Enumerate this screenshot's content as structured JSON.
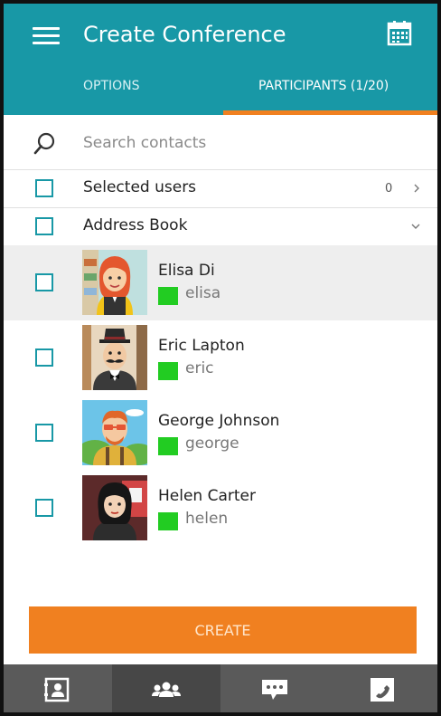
{
  "header": {
    "title": "Create Conference",
    "menu_icon": "hamburger-menu-icon",
    "calendar_icon": "calendar-icon",
    "background_color": "#1898a6",
    "tabs": [
      {
        "label": "OPTIONS",
        "active": false
      },
      {
        "label": "PARTICIPANTS (1/20)",
        "active": true
      }
    ],
    "tab_indicator_color": "#f08020"
  },
  "search": {
    "placeholder": "Search contacts",
    "value": "",
    "icon": "search-icon"
  },
  "selected_users": {
    "label": "Selected users",
    "count": "0",
    "icon": "chevron-right-icon"
  },
  "address_book": {
    "label": "Address Book",
    "icon": "chevron-down-icon"
  },
  "contacts": [
    {
      "name": "Elisa Di",
      "username": "elisa",
      "status_color": "#22cc22",
      "highlighted": true
    },
    {
      "name": "Eric Lapton",
      "username": "eric",
      "status_color": "#22cc22",
      "highlighted": false
    },
    {
      "name": "George Johnson",
      "username": "george",
      "status_color": "#22cc22",
      "highlighted": false
    },
    {
      "name": "Helen Carter",
      "username": "helen",
      "status_color": "#22cc22",
      "highlighted": false
    }
  ],
  "actions": {
    "create_label": "CREATE",
    "create_color": "#f08020"
  },
  "bottom_nav": [
    {
      "icon": "contact-card-icon",
      "active": false
    },
    {
      "icon": "group-icon",
      "active": true
    },
    {
      "icon": "chat-icon",
      "active": false
    },
    {
      "icon": "phone-icon",
      "active": false
    }
  ]
}
